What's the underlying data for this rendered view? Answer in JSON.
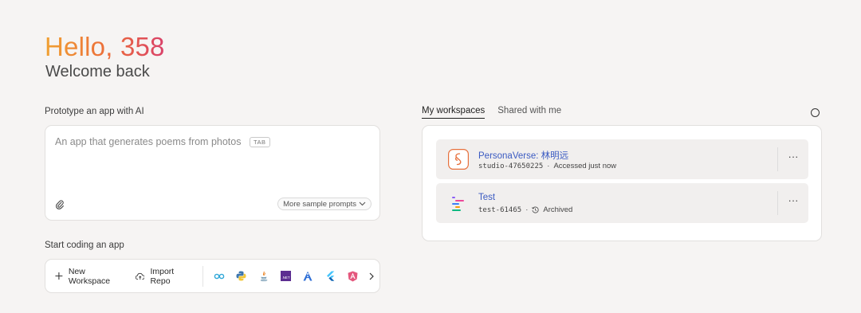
{
  "header": {
    "greeting": "Hello, 358",
    "subtitle": "Welcome back"
  },
  "prototype": {
    "label": "Prototype an app with AI",
    "placeholder": "An app that generates poems from photos",
    "tab_hint": "TAB",
    "sample_prompts_label": "More sample prompts"
  },
  "coding": {
    "label": "Start coding an app",
    "new_workspace": "New Workspace",
    "import_repo": "Import Repo",
    "templates": [
      "go-icon",
      "python-icon",
      "java-icon",
      "dotnet-icon",
      "angular-style-icon",
      "flutter-icon",
      "angular-icon"
    ],
    "dotnet_text": ".NET"
  },
  "workspaces": {
    "tabs": [
      {
        "label": "My workspaces",
        "active": true
      },
      {
        "label": "Shared with me",
        "active": false
      }
    ],
    "items": [
      {
        "name": "PersonaVerse: 林明远",
        "id": "studio-47650225",
        "status": "Accessed just now",
        "icon": "persona-icon"
      },
      {
        "name": "Test",
        "id": "test-61465",
        "status": "Archived",
        "icon": "project-icon"
      }
    ],
    "menu_label": "···",
    "separator": "·"
  },
  "colors": {
    "accent": "#3b5bc2",
    "greeting_gradient": [
      "#f0a132",
      "#ec6a3a",
      "#d9416a"
    ],
    "background": "#f6f4f3"
  }
}
